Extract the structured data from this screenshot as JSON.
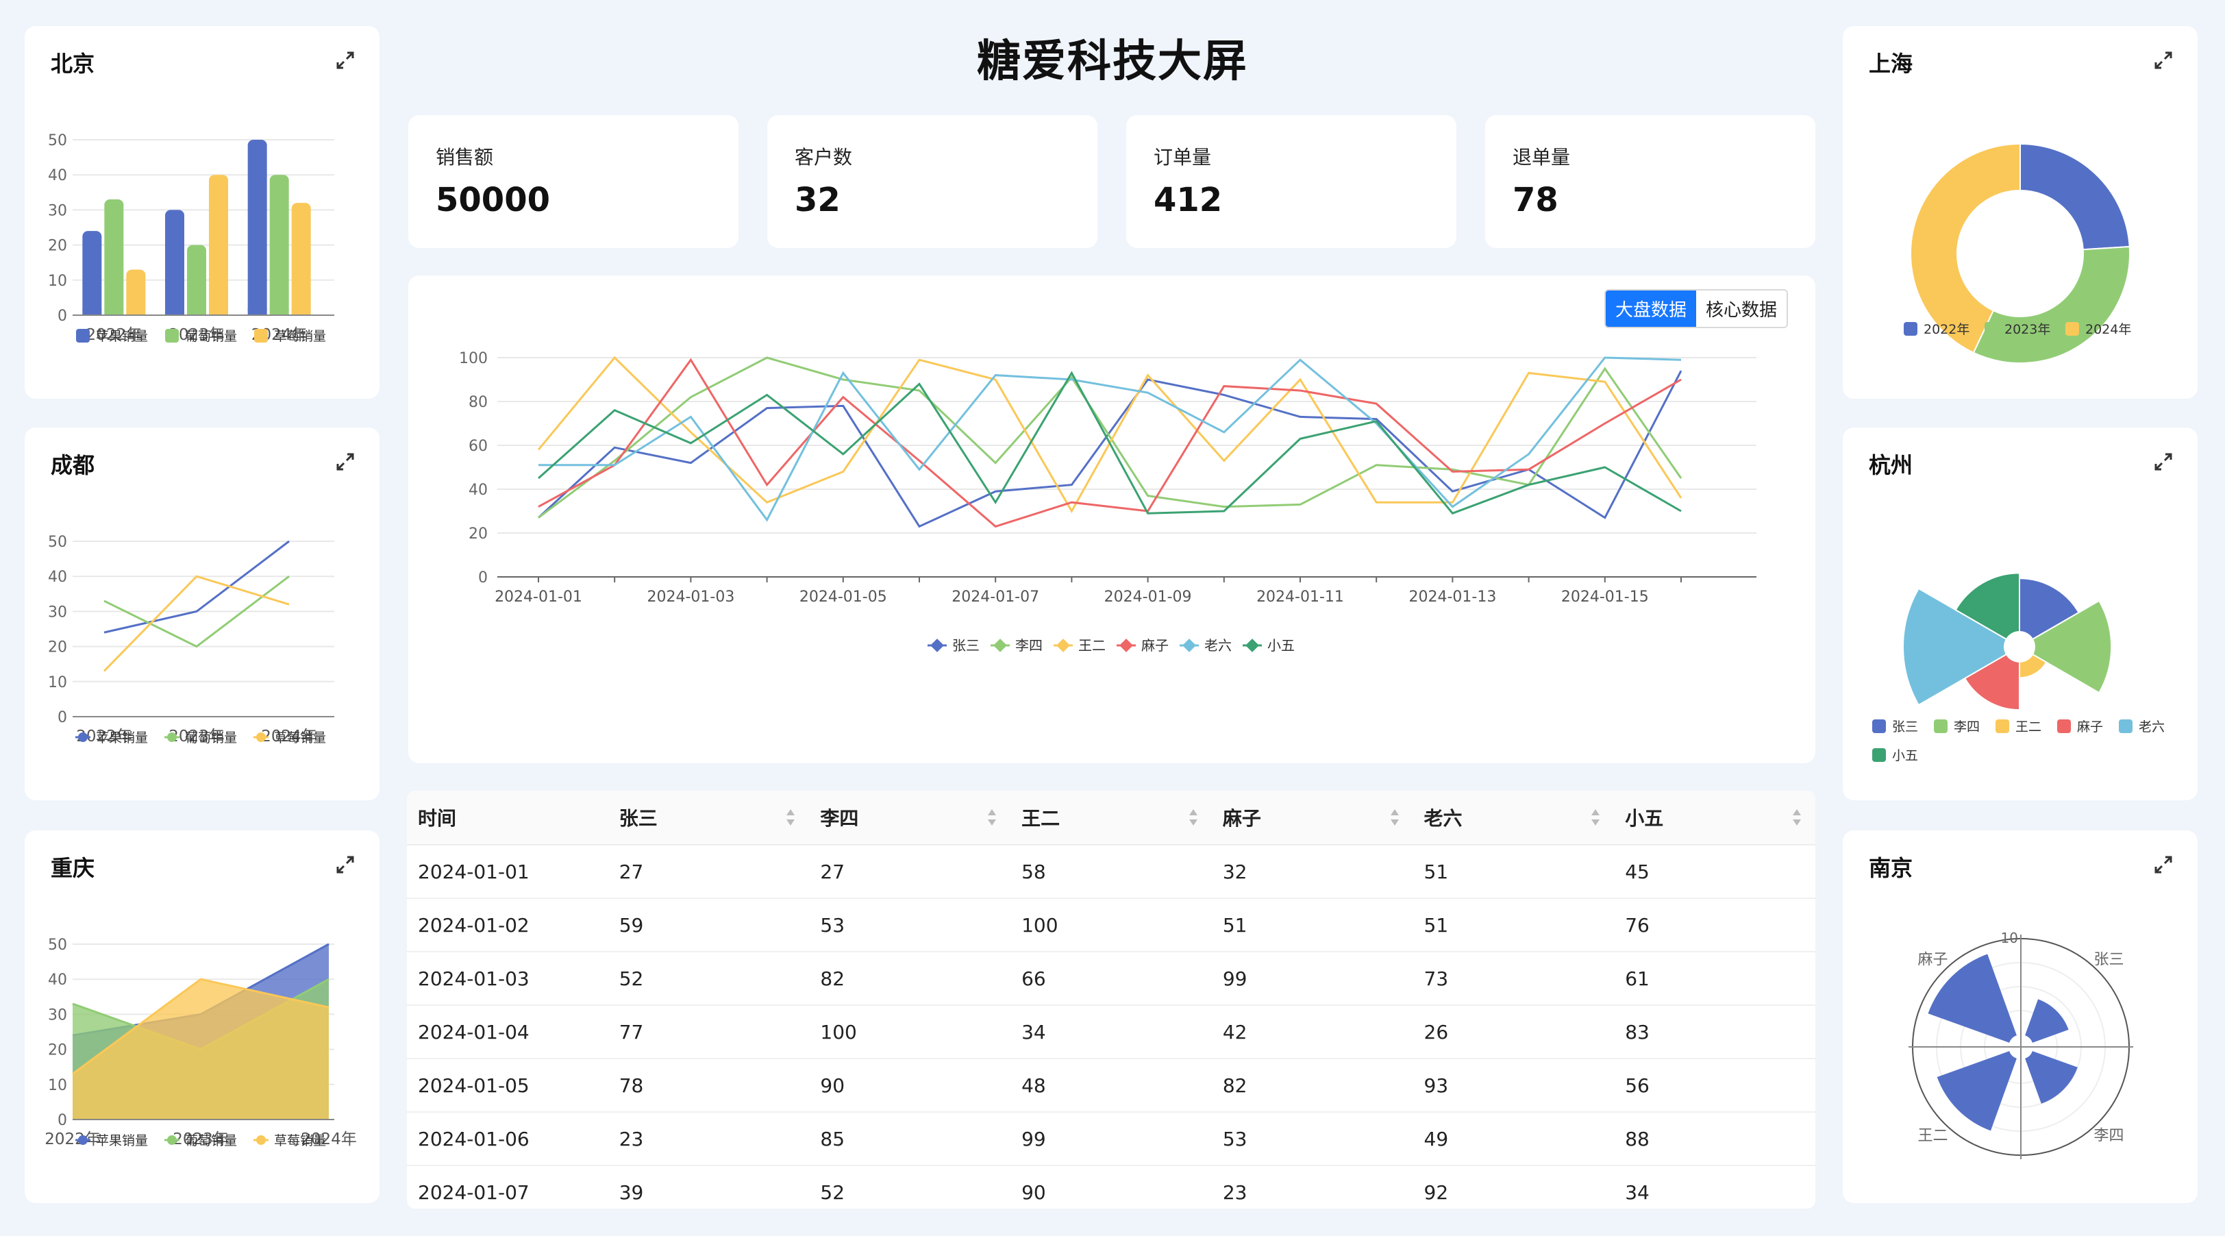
{
  "page_title": "糖爱科技大屏",
  "stats": [
    {
      "label": "销售额",
      "value": "50000"
    },
    {
      "label": "客户数",
      "value": "32"
    },
    {
      "label": "订单量",
      "value": "412"
    },
    {
      "label": "退单量",
      "value": "78"
    }
  ],
  "tabs": {
    "active": "大盘数据",
    "other": "核心数据"
  },
  "cities": {
    "beijing": "北京",
    "chengdu": "成都",
    "chongqing": "重庆",
    "shanghai": "上海",
    "hangzhou": "杭州",
    "nanjing": "南京"
  },
  "colors": {
    "blue": "#5470c6",
    "green": "#91cc75",
    "yellow": "#fac858",
    "red": "#ee6666",
    "cyan": "#73c0de",
    "teal": "#3ba272",
    "tab_active": "#1677ff"
  },
  "icons": {
    "expand": "expand-icon",
    "sort": "sort-icon"
  },
  "table": {
    "columns": [
      "时间",
      "张三",
      "李四",
      "王二",
      "麻子",
      "老六",
      "小五"
    ],
    "rows": [
      [
        "2024-01-01",
        "27",
        "27",
        "58",
        "32",
        "51",
        "45"
      ],
      [
        "2024-01-02",
        "59",
        "53",
        "100",
        "51",
        "51",
        "76"
      ],
      [
        "2024-01-03",
        "52",
        "82",
        "66",
        "99",
        "73",
        "61"
      ],
      [
        "2024-01-04",
        "77",
        "100",
        "34",
        "42",
        "26",
        "83"
      ],
      [
        "2024-01-05",
        "78",
        "90",
        "48",
        "82",
        "93",
        "56"
      ],
      [
        "2024-01-06",
        "23",
        "85",
        "99",
        "53",
        "49",
        "88"
      ],
      [
        "2024-01-07",
        "39",
        "52",
        "90",
        "23",
        "92",
        "34"
      ]
    ]
  },
  "chart_data": [
    {
      "id": "beijing",
      "type": "bar",
      "categories": [
        "2022年",
        "2023年",
        "2024年"
      ],
      "series": [
        {
          "name": "苹果销量",
          "values": [
            24,
            30,
            50
          ]
        },
        {
          "name": "葡萄销量",
          "values": [
            33,
            20,
            40
          ]
        },
        {
          "name": "草莓销量",
          "values": [
            13,
            40,
            32
          ]
        }
      ],
      "ylim": [
        0,
        50
      ],
      "yticks": [
        "0",
        "10",
        "20",
        "30",
        "40",
        "50"
      ],
      "legend": "bottom"
    },
    {
      "id": "chengdu",
      "type": "line",
      "categories": [
        "2022年",
        "2023年",
        "2024年"
      ],
      "series": [
        {
          "name": "苹果销量",
          "values": [
            24,
            30,
            50
          ]
        },
        {
          "name": "葡萄销量",
          "values": [
            33,
            20,
            40
          ]
        },
        {
          "name": "草莓销量",
          "values": [
            13,
            40,
            32
          ]
        }
      ],
      "ylim": [
        0,
        50
      ],
      "yticks": [
        "0",
        "10",
        "20",
        "30",
        "40",
        "50"
      ],
      "legend": "bottom"
    },
    {
      "id": "chongqing",
      "type": "area",
      "categories": [
        "2022年",
        "2023年",
        "2024年"
      ],
      "series": [
        {
          "name": "苹果销量",
          "values": [
            24,
            30,
            50
          ]
        },
        {
          "name": "葡萄销量",
          "values": [
            33,
            20,
            40
          ]
        },
        {
          "name": "草莓销量",
          "values": [
            13,
            40,
            32
          ]
        }
      ],
      "ylim": [
        0,
        50
      ],
      "yticks": [
        "0",
        "10",
        "20",
        "30",
        "40",
        "50"
      ],
      "legend": "bottom"
    },
    {
      "id": "main",
      "type": "line",
      "x": [
        "2024-01-01",
        "2024-01-02",
        "2024-01-03",
        "2024-01-04",
        "2024-01-05",
        "2024-01-06",
        "2024-01-07",
        "2024-01-08",
        "2024-01-09",
        "2024-01-10",
        "2024-01-11",
        "2024-01-12",
        "2024-01-13",
        "2024-01-14",
        "2024-01-15",
        "2024-01-16"
      ],
      "xticks": [
        "2024-01-01",
        "2024-01-03",
        "2024-01-05",
        "2024-01-07",
        "2024-01-09",
        "2024-01-11",
        "2024-01-13",
        "2024-01-15"
      ],
      "series": [
        {
          "name": "张三",
          "values": [
            27,
            59,
            52,
            77,
            78,
            23,
            39,
            42,
            90,
            83,
            73,
            72,
            39,
            49,
            27,
            94
          ]
        },
        {
          "name": "李四",
          "values": [
            27,
            53,
            82,
            100,
            90,
            85,
            52,
            91,
            37,
            32,
            33,
            51,
            49,
            42,
            95,
            45
          ]
        },
        {
          "name": "王二",
          "values": [
            58,
            100,
            66,
            34,
            48,
            99,
            90,
            30,
            92,
            53,
            90,
            34,
            34,
            93,
            89,
            36
          ]
        },
        {
          "name": "麻子",
          "values": [
            32,
            51,
            99,
            42,
            82,
            53,
            23,
            34,
            30,
            87,
            85,
            79,
            48,
            49,
            70,
            90
          ]
        },
        {
          "name": "老六",
          "values": [
            51,
            51,
            73,
            26,
            93,
            49,
            92,
            90,
            84,
            66,
            99,
            70,
            32,
            56,
            100,
            99
          ]
        },
        {
          "name": "小五",
          "values": [
            45,
            76,
            61,
            83,
            56,
            88,
            34,
            93,
            29,
            30,
            63,
            71,
            29,
            42,
            50,
            30
          ]
        }
      ],
      "ylim": [
        0,
        100
      ],
      "yticks": [
        "0",
        "20",
        "40",
        "60",
        "80",
        "100"
      ],
      "legend": "bottom"
    },
    {
      "id": "shanghai",
      "type": "pie",
      "labels": [
        "2022年",
        "2023年",
        "2024年"
      ],
      "values": [
        24,
        33,
        43
      ],
      "donut": true,
      "legend": "bottom"
    },
    {
      "id": "hangzhou",
      "type": "pie",
      "rose": true,
      "labels": [
        "张三",
        "李四",
        "王二",
        "麻子",
        "老六",
        "小五"
      ],
      "values": [
        50,
        72,
        15,
        45,
        95,
        55
      ],
      "legend": "bottom"
    },
    {
      "id": "nanjing",
      "type": "bar",
      "polar": true,
      "categories": [
        "张三",
        "李四",
        "王二",
        "麻子"
      ],
      "values": [
        4,
        5,
        8,
        9
      ],
      "rlim": [
        0,
        10
      ],
      "rtick": "10"
    }
  ]
}
